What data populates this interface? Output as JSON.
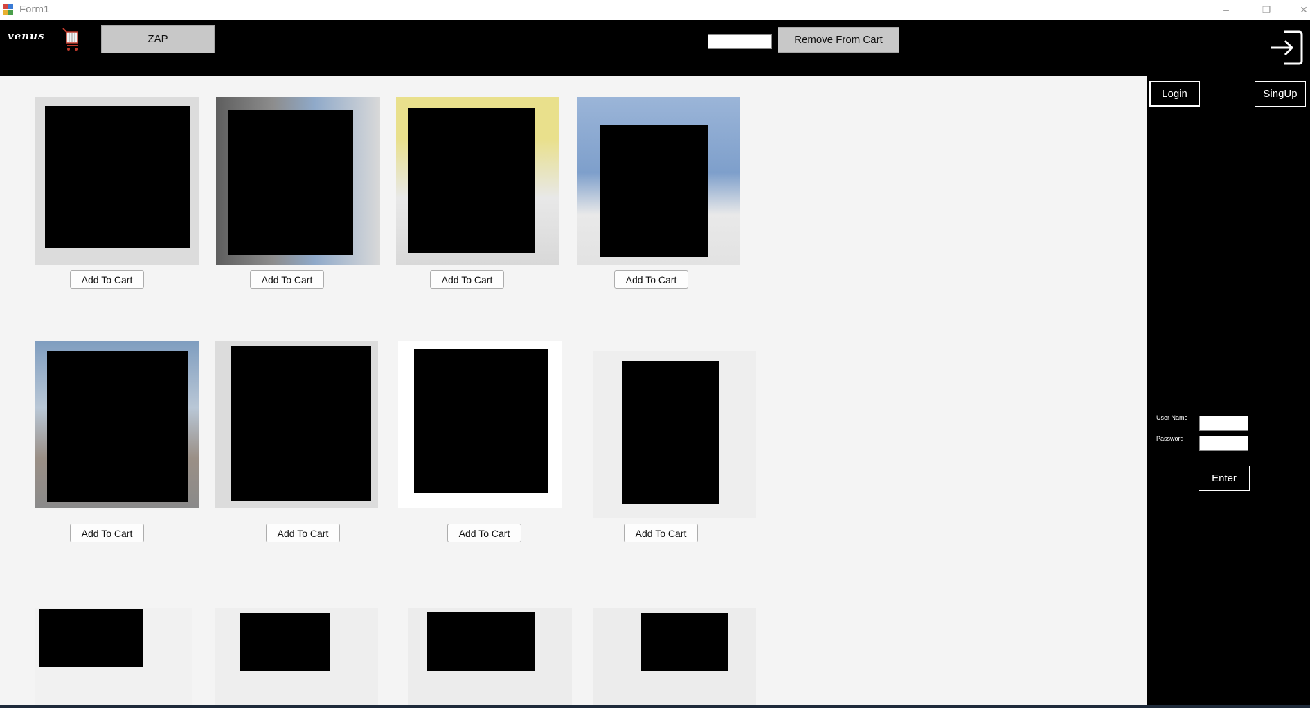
{
  "window": {
    "title": "Form1",
    "controls": {
      "minimize": "–",
      "restore": "❐",
      "close": "✕"
    }
  },
  "toolbar": {
    "logo": "venus",
    "zap_label": "ZAP",
    "cart_field_value": "",
    "remove_label": "Remove From Cart"
  },
  "products": {
    "add_label": "Add To Cart",
    "rows": [
      {
        "items": [
          {
            "bg": "#dcdcdc"
          },
          {
            "bg": "#7e8fa6"
          },
          {
            "bg": "#e9e08c"
          },
          {
            "bg": "#9bb5d8"
          }
        ]
      },
      {
        "items": [
          {
            "bg": "#7f9dbf"
          },
          {
            "bg": "#dcdcdc"
          },
          {
            "bg": "#ffffff"
          },
          {
            "bg": "#eeeeee"
          }
        ]
      },
      {
        "items": [
          {
            "bg": "#f1f1f1"
          },
          {
            "bg": "#eeeeee"
          },
          {
            "bg": "#ececec"
          },
          {
            "bg": "#ececec"
          }
        ]
      }
    ]
  },
  "sidebar": {
    "login_label": "Login",
    "signup_label": "SingUp",
    "username_label": "User Name",
    "password_label": "Password",
    "username_value": "",
    "password_value": "",
    "enter_label": "Enter"
  },
  "colors": {
    "page_bg": "#f4f4f4",
    "dark_bg": "#000000",
    "button_gray": "#c8c8c8"
  }
}
